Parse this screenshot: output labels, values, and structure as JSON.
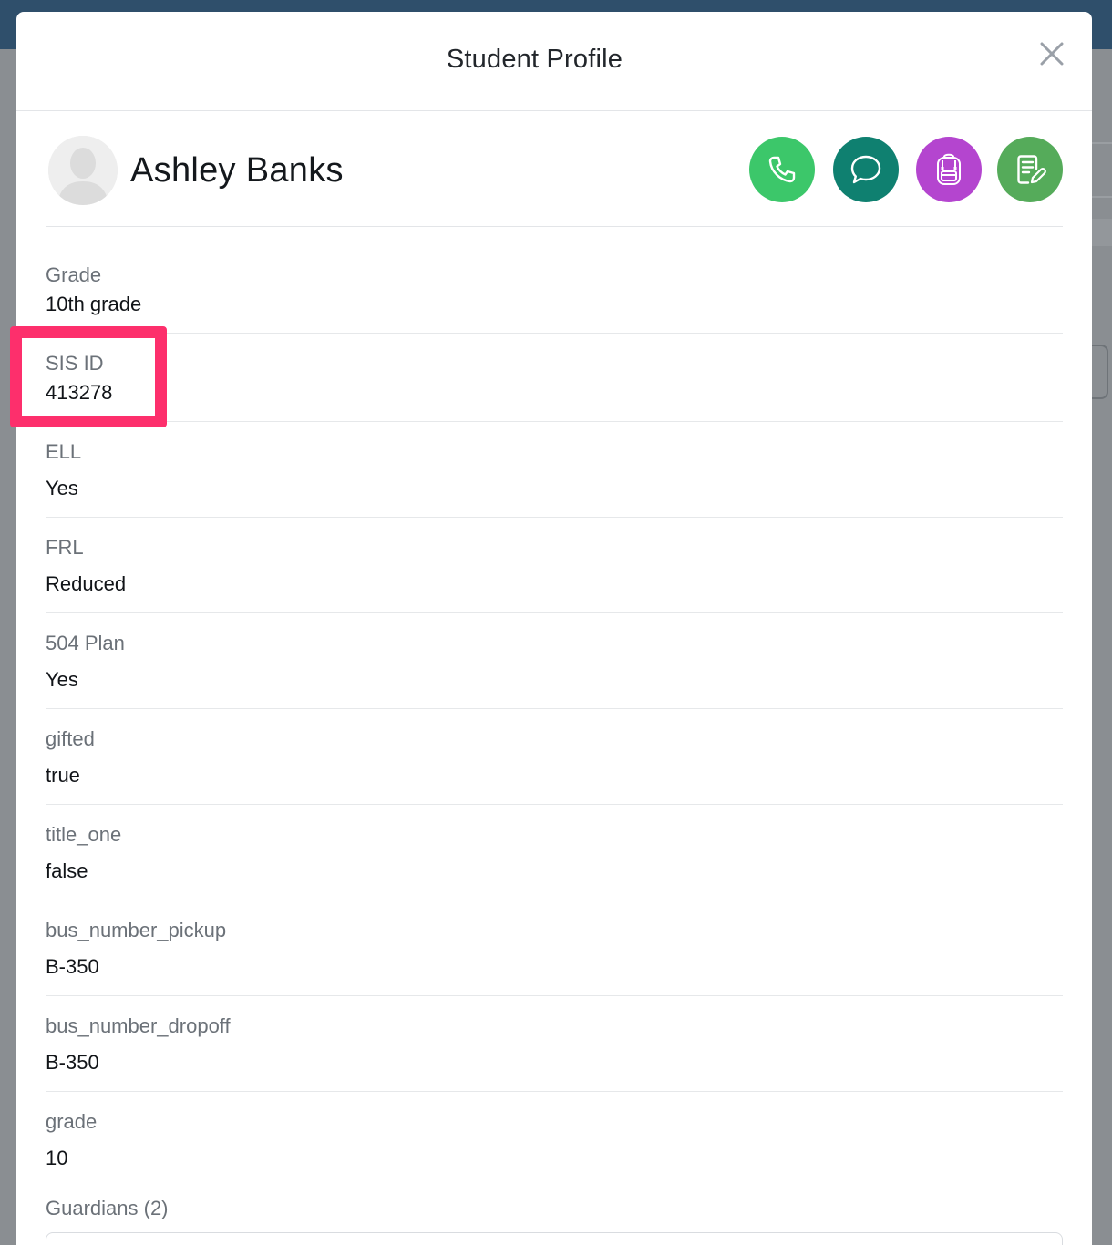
{
  "modal": {
    "title": "Student Profile"
  },
  "student": {
    "name": "Ashley Banks"
  },
  "actions": [
    {
      "name": "call",
      "icon": "phone-icon",
      "color": "#3cc76a"
    },
    {
      "name": "message",
      "icon": "chat-bubble-icon",
      "color": "#0f8070"
    },
    {
      "name": "backpack",
      "icon": "backpack-icon",
      "color": "#b445cf"
    },
    {
      "name": "notes",
      "icon": "notepad-pencil-icon",
      "color": "#55ab5a"
    }
  ],
  "fields": [
    {
      "label": "Grade",
      "value": "10th grade"
    },
    {
      "label": "SIS ID",
      "value": "413278"
    },
    {
      "label": "ELL",
      "value": "Yes"
    },
    {
      "label": "FRL",
      "value": "Reduced"
    },
    {
      "label": "504 Plan",
      "value": "Yes"
    },
    {
      "label": "gifted",
      "value": "true"
    },
    {
      "label": "title_one",
      "value": "false"
    },
    {
      "label": "bus_number_pickup",
      "value": "B-350"
    },
    {
      "label": "bus_number_dropoff",
      "value": "B-350"
    },
    {
      "label": "grade",
      "value": "10"
    }
  ],
  "guardians": {
    "label": "Guardians (2)"
  },
  "highlight_color": "#fd2f6c"
}
